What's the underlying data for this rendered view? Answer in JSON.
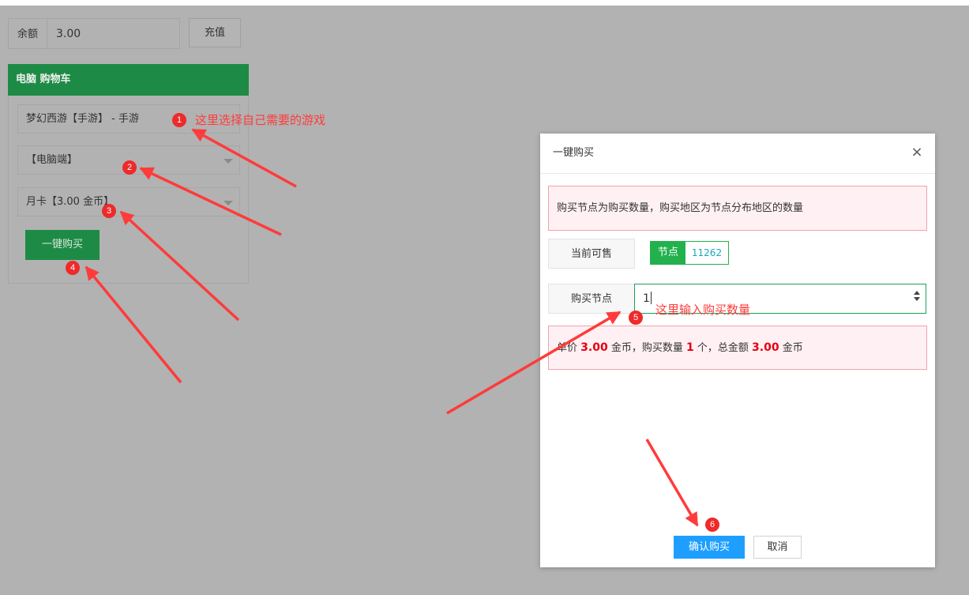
{
  "balance": {
    "label": "余额",
    "value": "3.00",
    "recharge_label": "充值"
  },
  "cart": {
    "title": "电脑 购物车",
    "game_select": "梦幻西游【手游】 - 手游",
    "platform_select": "【电脑端】",
    "plan_select": "月卡【3.00 金币】",
    "buy_label": "一键购买"
  },
  "annotations": {
    "note_game": "这里选择自己需要的游戏",
    "note_qty": "这里输入购买数量",
    "badges": [
      "1",
      "2",
      "3",
      "4",
      "5",
      "6"
    ]
  },
  "modal": {
    "title": "一键购买",
    "close_icon": "close-icon",
    "notice": "购买节点为购买数量，购买地区为节点分布地区的数量",
    "available_label": "当前可售",
    "node_tag_label": "节点",
    "node_count": "11262",
    "qty_label": "购买节点",
    "qty_value": "1",
    "summary": {
      "unit_label": "单价",
      "unit_price": "3.00",
      "unit_currency": "金币，购买数量",
      "qty": "1",
      "qty_unit": "个，总金额",
      "total": "3.00",
      "total_currency": "金币"
    },
    "confirm_label": "确认购买",
    "cancel_label": "取消"
  },
  "colors": {
    "green": "#1d8b45",
    "tag_green": "#22b14c",
    "primary_blue": "#1e9fff",
    "annotation_red": "#ff3b3b",
    "alert_bg": "#fff0f3"
  }
}
